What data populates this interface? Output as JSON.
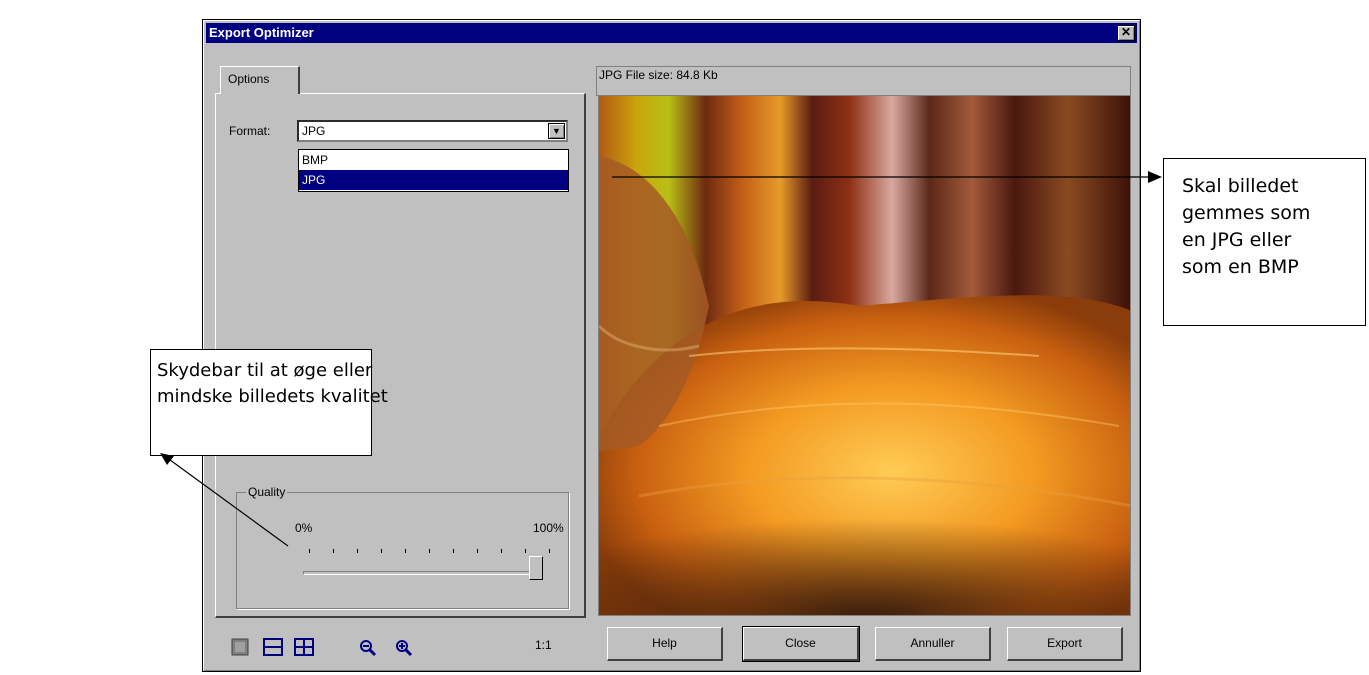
{
  "dialog": {
    "title": "Export Optimizer",
    "close_glyph": "✕",
    "tabs": [
      "Options"
    ],
    "format_label": "Format:",
    "format_value": "JPG",
    "format_options": [
      "BMP",
      "JPG"
    ],
    "format_selected": "JPG",
    "quality": {
      "group_label": "Quality",
      "min_label": "0%",
      "max_label": "100%",
      "value_percent": 100
    },
    "preview": {
      "header": "JPG File size:  84.8 Kb"
    },
    "toolbar": {
      "icons": [
        "single-view-icon",
        "two-split-view-icon",
        "four-split-view-icon",
        "zoom-out-icon",
        "zoom-in-icon"
      ],
      "zoom_label": "1:1"
    },
    "buttons": {
      "help": "Help",
      "close": "Close",
      "cancel": "Annuller",
      "export": "Export"
    }
  },
  "annotations": {
    "format_callout": [
      "Skal billedet",
      "gemmes som",
      "en JPG eller",
      "som en BMP"
    ],
    "quality_callout": [
      "Skydebar til at øge eller",
      "mindske billedets kvalitet"
    ]
  },
  "colors": {
    "title_bar": "#000080",
    "window": "#c0c0c0",
    "selection": "#000080"
  }
}
